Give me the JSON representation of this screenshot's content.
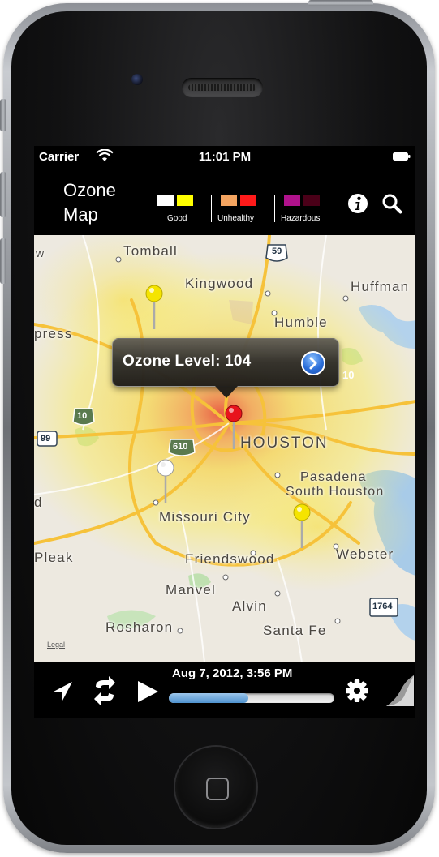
{
  "status_bar": {
    "carrier": "Carrier",
    "time": "11:01 PM",
    "icons": [
      "wifi-icon",
      "battery-icon"
    ]
  },
  "header": {
    "title_line1": "Ozone",
    "title_line2": "Map",
    "legend": [
      {
        "label": "Good",
        "colors": [
          "#ffffff",
          "#ffff00"
        ]
      },
      {
        "label": "Unhealthy",
        "colors": [
          "#f4a460",
          "#ff1a1a"
        ]
      },
      {
        "label": "Hazardous",
        "colors": [
          "#b0128c",
          "#4a0018"
        ]
      }
    ],
    "icons": [
      "info-icon",
      "search-icon"
    ]
  },
  "map": {
    "callout": {
      "text": "Ozone Level: 104",
      "icon": "disclosure-arrow-icon"
    },
    "labels": {
      "tomball": "Tomball",
      "kingwood": "Kingwood",
      "huffman": "Huffman",
      "humble": "Humble",
      "cypress": "press",
      "houston": "HOUSTON",
      "pasadena": "Pasadena",
      "south_houston": "South Houston",
      "missouri_city": "Missouri City",
      "pleak": "Pleak",
      "friendswood": "Friendswood",
      "webster": "Webster",
      "manvel": "Manvel",
      "alvin": "Alvin",
      "rosharon": "Rosharon",
      "santa_fe": "Santa Fe",
      "west_edge": "w",
      "d_edge": "d"
    },
    "shields": {
      "i59": "59",
      "i10": "10",
      "i610": "610",
      "r99": "99",
      "r1764": "1764",
      "i10_east": "10"
    },
    "legal": "Legal",
    "pins": [
      {
        "color": "#f5e400",
        "name": "yellow-pin"
      },
      {
        "color": "#e8141c",
        "name": "red-pin"
      },
      {
        "color": "#ffffff",
        "name": "white-pin"
      },
      {
        "color": "#f5e400",
        "name": "yellow-pin"
      }
    ]
  },
  "toolbar": {
    "date": "Aug 7, 2012, 3:56 PM",
    "progress": 0.48,
    "icons": [
      "location-arrow-icon",
      "refresh-icon",
      "play-icon",
      "gear-icon",
      "page-curl-icon"
    ]
  }
}
